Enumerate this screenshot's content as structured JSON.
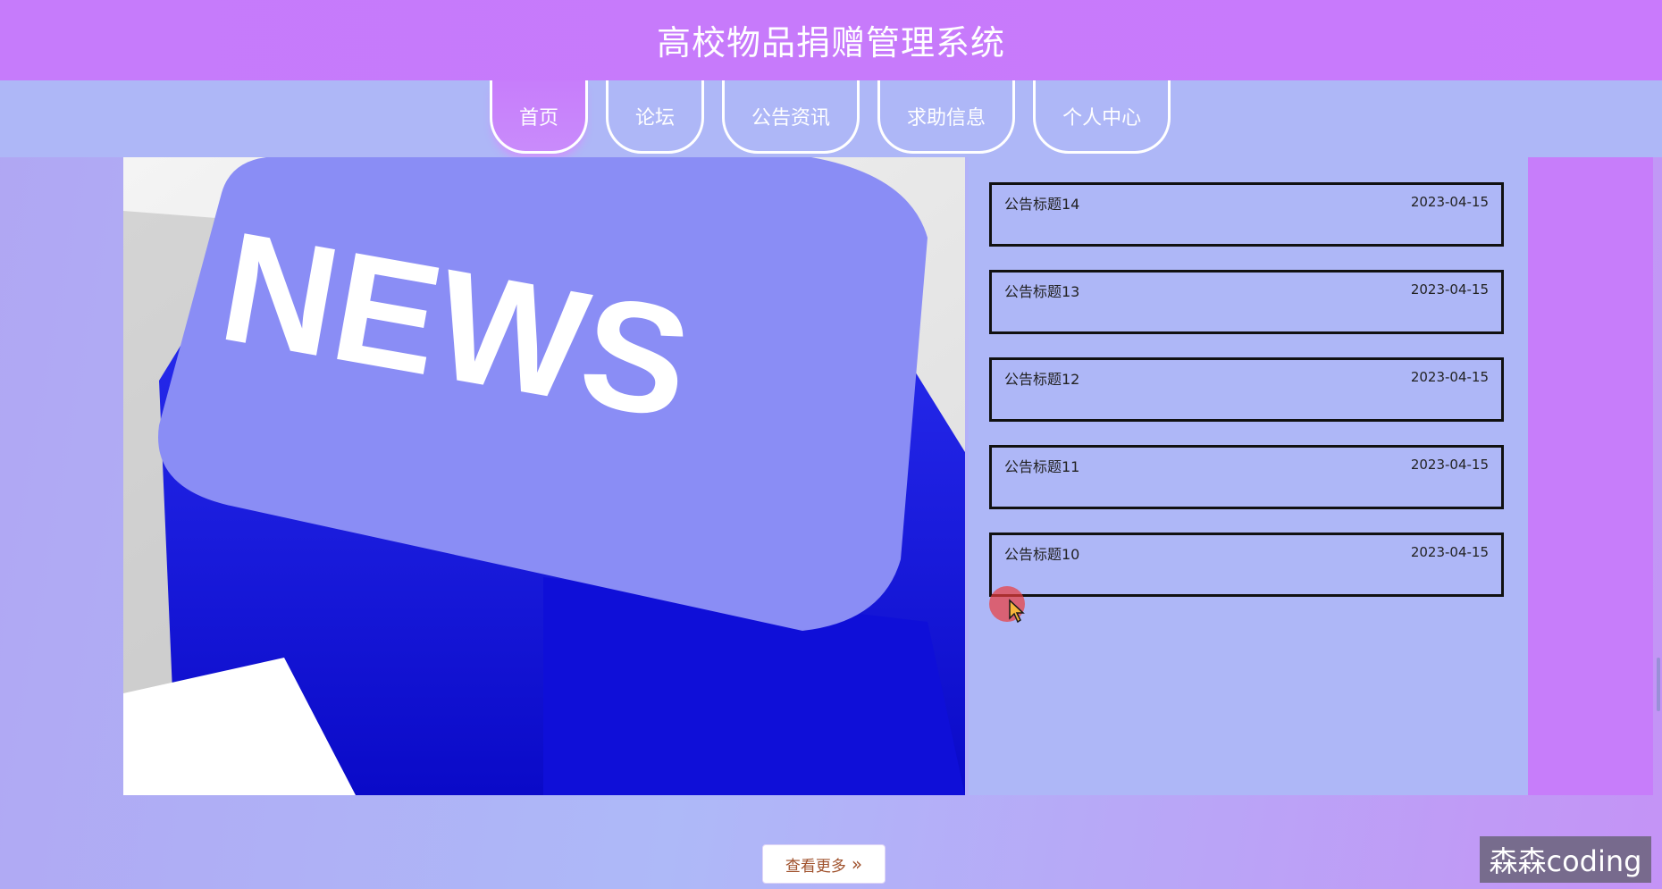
{
  "header": {
    "title": "高校物品捐赠管理系统"
  },
  "nav": {
    "tabs": [
      {
        "label": "首页",
        "active": true
      },
      {
        "label": "论坛",
        "active": false
      },
      {
        "label": "公告资讯",
        "active": false
      },
      {
        "label": "求助信息",
        "active": false
      },
      {
        "label": "个人中心",
        "active": false
      }
    ]
  },
  "hero": {
    "image_text": "NEWS"
  },
  "news": {
    "items": [
      {
        "title": "公告标题14",
        "date": "2023-04-15"
      },
      {
        "title": "公告标题13",
        "date": "2023-04-15"
      },
      {
        "title": "公告标题12",
        "date": "2023-04-15"
      },
      {
        "title": "公告标题11",
        "date": "2023-04-15"
      },
      {
        "title": "公告标题10",
        "date": "2023-04-15"
      }
    ]
  },
  "more_button": {
    "label": "查看更多",
    "icon": "double-chevron-right-icon"
  },
  "watermark": {
    "text": "森森coding"
  },
  "colors": {
    "header": "#c77afb",
    "nav_band": "#aeb7f7",
    "content_bg": "#aeb7f7",
    "key_blue": "#8a8df5",
    "more_text": "#a0522d"
  }
}
